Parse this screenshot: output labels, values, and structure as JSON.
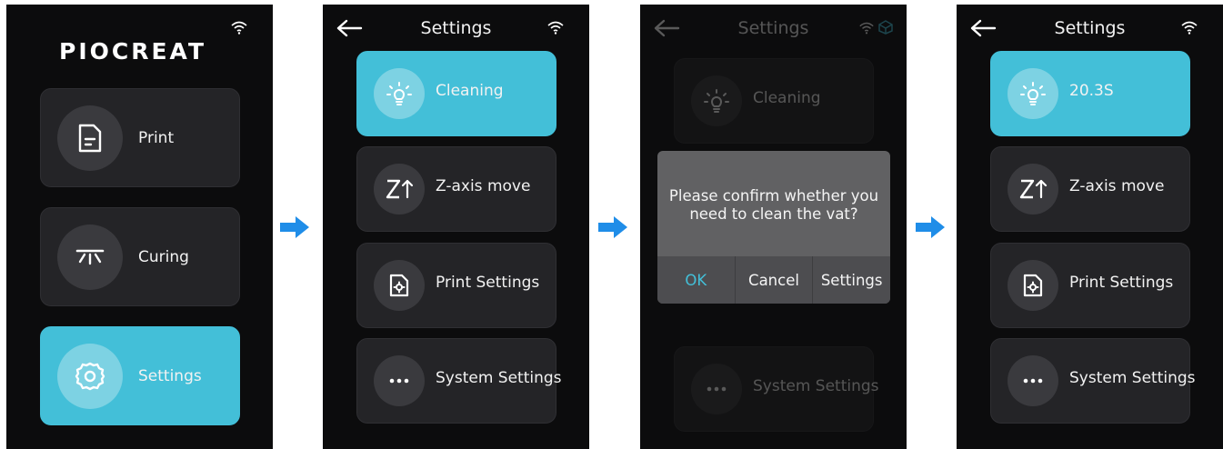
{
  "colors": {
    "accent": "#43bfd8",
    "card": "#242427",
    "screen": "#0c0c0d",
    "arrow": "#1f8de8"
  },
  "screen1": {
    "logo": "PIOCREAT",
    "menu": [
      {
        "label": "Print",
        "icon": "file-icon"
      },
      {
        "label": "Curing",
        "icon": "uv-lamp-icon"
      },
      {
        "label": "Settings",
        "icon": "gear-icon",
        "active": true
      }
    ]
  },
  "screen2": {
    "title": "Settings",
    "menu": [
      {
        "label": "Cleaning",
        "icon": "bulb-icon",
        "active": true
      },
      {
        "label": "Z-axis move",
        "icon": "z-axis-icon"
      },
      {
        "label": "Print Settings",
        "icon": "file-settings-icon"
      },
      {
        "label": "System Settings",
        "icon": "more-icon"
      }
    ]
  },
  "screen3": {
    "title": "Settings",
    "menu": [
      {
        "label": "Cleaning",
        "icon": "bulb-icon"
      },
      {
        "label": "System Settings",
        "icon": "more-icon"
      }
    ],
    "dialog": {
      "message_line1": "Please confirm whether you",
      "message_line2": "need to clean the vat?",
      "ok": "OK",
      "cancel": "Cancel",
      "settings": "Settings"
    }
  },
  "screen4": {
    "title": "Settings",
    "menu": [
      {
        "label": "20.3S",
        "icon": "bulb-icon",
        "active": true
      },
      {
        "label": "Z-axis move",
        "icon": "z-axis-icon"
      },
      {
        "label": "Print Settings",
        "icon": "file-settings-icon"
      },
      {
        "label": "System Settings",
        "icon": "more-icon"
      }
    ]
  }
}
